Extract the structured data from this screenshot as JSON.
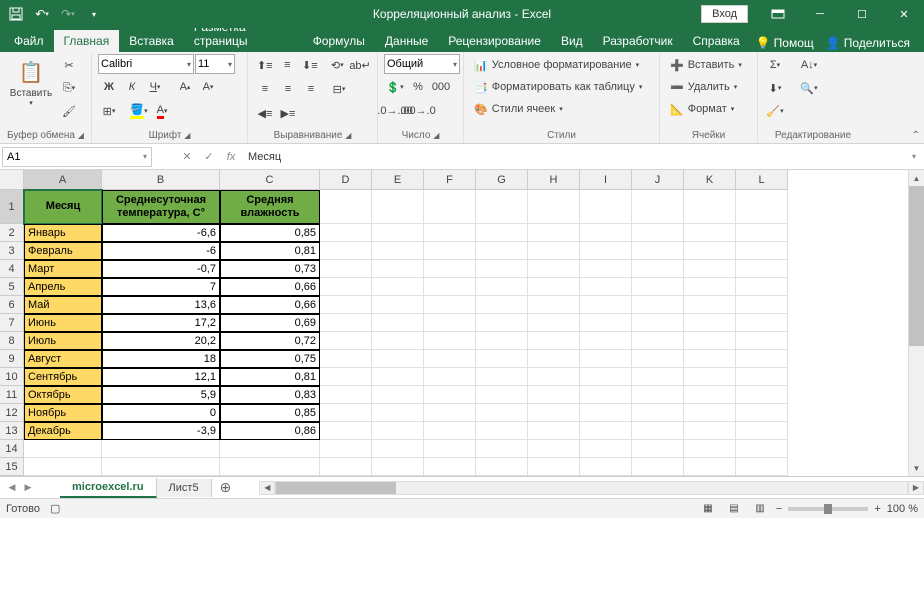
{
  "titlebar": {
    "title": "Корреляционный анализ  -  Excel",
    "login": "Вход"
  },
  "tabs": {
    "file": "Файл",
    "home": "Главная",
    "insert": "Вставка",
    "layout": "Разметка страницы",
    "formulas": "Формулы",
    "data": "Данные",
    "review": "Рецензирование",
    "view": "Вид",
    "developer": "Разработчик",
    "help": "Справка",
    "tell_me": "Помощ",
    "share": "Поделиться"
  },
  "ribbon": {
    "clipboard": {
      "paste": "Вставить",
      "label": "Буфер обмена"
    },
    "font": {
      "name": "Calibri",
      "size": "11",
      "label": "Шрифт"
    },
    "alignment": {
      "label": "Выравнивание"
    },
    "number": {
      "format": "Общий",
      "label": "Число"
    },
    "styles": {
      "cond": "Условное форматирование",
      "table": "Форматировать как таблицу",
      "cell": "Стили ячеек",
      "label": "Стили"
    },
    "cells": {
      "insert": "Вставить",
      "delete": "Удалить",
      "format": "Формат",
      "label": "Ячейки"
    },
    "editing": {
      "label": "Редактирование"
    }
  },
  "formula_bar": {
    "name_box": "A1",
    "fx": "fx",
    "value": "Месяц"
  },
  "columns": [
    "A",
    "B",
    "C",
    "D",
    "E",
    "F",
    "G",
    "H",
    "I",
    "J",
    "K",
    "L"
  ],
  "col_widths": {
    "A": 78,
    "B": 118,
    "C": 100,
    "other": 52
  },
  "headers": {
    "month": "Месяц",
    "temp": "Среднесуточная температура, С°",
    "humidity": "Средняя влажность"
  },
  "data_rows": [
    {
      "n": 2,
      "month": "Январь",
      "temp": "-6,6",
      "hum": "0,85"
    },
    {
      "n": 3,
      "month": "Февраль",
      "temp": "-6",
      "hum": "0,81"
    },
    {
      "n": 4,
      "month": "Март",
      "temp": "-0,7",
      "hum": "0,73"
    },
    {
      "n": 5,
      "month": "Апрель",
      "temp": "7",
      "hum": "0,66"
    },
    {
      "n": 6,
      "month": "Май",
      "temp": "13,6",
      "hum": "0,66"
    },
    {
      "n": 7,
      "month": "Июнь",
      "temp": "17,2",
      "hum": "0,69"
    },
    {
      "n": 8,
      "month": "Июль",
      "temp": "20,2",
      "hum": "0,72"
    },
    {
      "n": 9,
      "month": "Август",
      "temp": "18",
      "hum": "0,75"
    },
    {
      "n": 10,
      "month": "Сентябрь",
      "temp": "12,1",
      "hum": "0,81"
    },
    {
      "n": 11,
      "month": "Октябрь",
      "temp": "5,9",
      "hum": "0,83"
    },
    {
      "n": 12,
      "month": "Ноябрь",
      "temp": "0",
      "hum": "0,85"
    },
    {
      "n": 13,
      "month": "Декабрь",
      "temp": "-3,9",
      "hum": "0,86"
    }
  ],
  "empty_rows": [
    14,
    15
  ],
  "sheets": {
    "active": "microexcel.ru",
    "other": "Лист5"
  },
  "status": {
    "ready": "Готово",
    "zoom": "100 %"
  }
}
